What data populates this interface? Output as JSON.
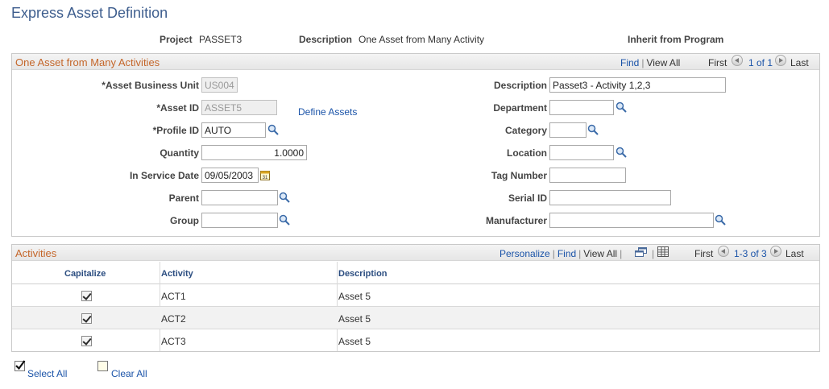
{
  "page": {
    "title": "Express Asset Definition"
  },
  "header": {
    "project_label": "Project",
    "project_value": "PASSET3",
    "description_label": "Description",
    "description_value": "One Asset from Many Activity",
    "inherit_label": "Inherit from Program"
  },
  "asset_panel": {
    "title": "One Asset from Many Activities",
    "nav": {
      "find": "Find",
      "view_all": "View All",
      "first": "First",
      "range": "1 of 1",
      "last": "Last"
    },
    "fields": {
      "business_unit_label": "*Asset Business Unit",
      "business_unit_value": "US004",
      "asset_id_label": "*Asset ID",
      "asset_id_value": "ASSET5",
      "define_assets_link": "Define Assets",
      "profile_id_label": "*Profile ID",
      "profile_id_value": "AUTO",
      "quantity_label": "Quantity",
      "quantity_value": "1.0000",
      "in_service_date_label": "In Service Date",
      "in_service_date_value": "09/05/2003",
      "parent_label": "Parent",
      "parent_value": "",
      "group_label": "Group",
      "group_value": "",
      "description_label": "Description",
      "description_value": "Passet3 - Activity 1,2,3",
      "department_label": "Department",
      "department_value": "",
      "category_label": "Category",
      "category_value": "",
      "location_label": "Location",
      "location_value": "",
      "tag_number_label": "Tag Number",
      "tag_number_value": "",
      "serial_id_label": "Serial ID",
      "serial_id_value": "",
      "manufacturer_label": "Manufacturer",
      "manufacturer_value": ""
    }
  },
  "activities": {
    "title": "Activities",
    "nav": {
      "personalize": "Personalize",
      "find": "Find",
      "view_all": "View All",
      "first": "First",
      "range": "1-3 of 3",
      "last": "Last"
    },
    "columns": {
      "capitalize": "Capitalize",
      "activity": "Activity",
      "description": "Description"
    },
    "rows": [
      {
        "capitalize": true,
        "activity": "ACT1",
        "description": "Asset 5"
      },
      {
        "capitalize": true,
        "activity": "ACT2",
        "description": "Asset 5"
      },
      {
        "capitalize": true,
        "activity": "ACT3",
        "description": "Asset 5"
      }
    ]
  },
  "footer": {
    "select_all": "Select All",
    "clear_all": "Clear All"
  },
  "icons": {
    "lookup": "magnifier-icon",
    "calendar": "calendar-icon",
    "first_arrow": "arrow-left-icon",
    "last_arrow": "arrow-right-icon",
    "new_window": "new-window-icon",
    "download": "spreadsheet-icon"
  },
  "colors": {
    "title": "#3e5e8e",
    "panel_title": "#c4662a",
    "link": "#1a53a8"
  }
}
